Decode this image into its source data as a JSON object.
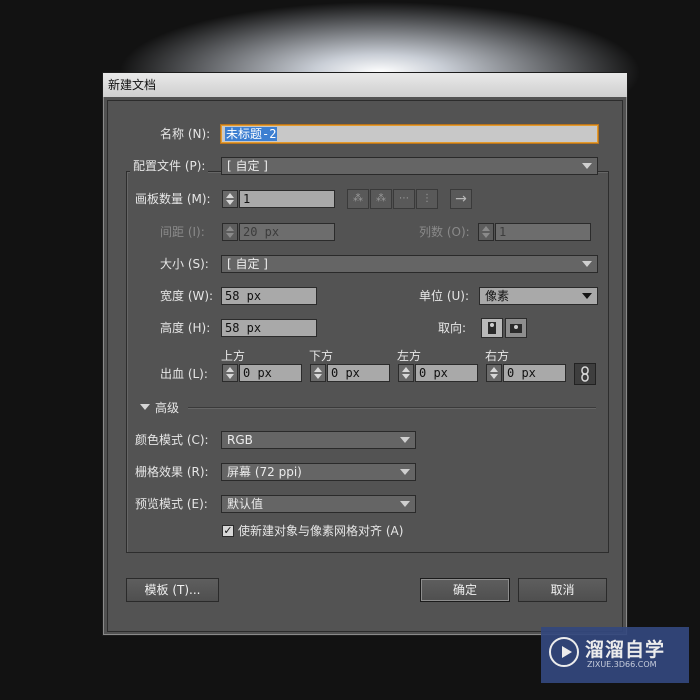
{
  "dialog": {
    "title": "新建文档",
    "name_label": "名称 (N):",
    "name_value": "未标题-2",
    "profile_label": "配置文件 (P):",
    "profile_value": "[ 自定 ]",
    "artboards_label": "画板数量 (M):",
    "artboards_value": "1",
    "arrange_arrow": "→",
    "spacing_label": "间距 (I):",
    "spacing_value": "20 px",
    "columns_label": "列数 (O):",
    "columns_value": "1",
    "size_label": "大小 (S):",
    "size_value": "[ 自定 ]",
    "width_label": "宽度 (W):",
    "width_value": "58 px",
    "units_label": "单位 (U):",
    "units_value": "像素",
    "height_label": "高度 (H):",
    "height_value": "58 px",
    "orientation_label": "取向:",
    "bleed_label": "出血 (L):",
    "bleed_top_label": "上方",
    "bleed_top_value": "0 px",
    "bleed_bottom_label": "下方",
    "bleed_bottom_value": "0 px",
    "bleed_left_label": "左方",
    "bleed_left_value": "0 px",
    "bleed_right_label": "右方",
    "bleed_right_value": "0 px",
    "advanced_label": "高级",
    "color_mode_label": "颜色模式 (C):",
    "color_mode_value": "RGB",
    "raster_label": "栅格效果 (R):",
    "raster_value": "屏幕 (72 ppi)",
    "preview_label": "预览模式 (E):",
    "preview_value": "默认值",
    "align_checkbox_label": "使新建对象与像素网格对齐 (A)",
    "align_checked": true,
    "templates_button": "模板 (T)...",
    "ok_button": "确定",
    "cancel_button": "取消"
  },
  "watermark": {
    "title": "溜溜自学",
    "subtitle": "ZIXUE.3D66.COM"
  },
  "colors": {
    "dialog_bg": "#535353",
    "field_bg": "#a9a9a9",
    "focus_orange": "#e39b2e",
    "selection_blue": "#3d7fd1"
  }
}
